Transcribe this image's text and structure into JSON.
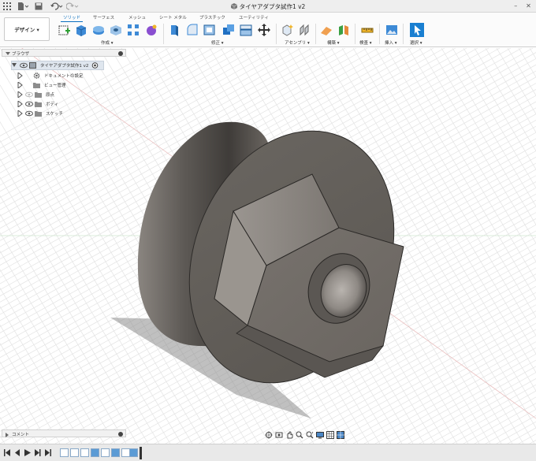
{
  "window": {
    "title": "タイヤアダプタ試作1 v2"
  },
  "ribbon": {
    "workspace_button": "デザイン ▾",
    "tabs": [
      {
        "label": "ソリッド",
        "active": true
      },
      {
        "label": "サーフェス",
        "active": false
      },
      {
        "label": "メッシュ",
        "active": false
      },
      {
        "label": "シート メタル",
        "active": false
      },
      {
        "label": "プラスチック",
        "active": false
      },
      {
        "label": "ユーティリティ",
        "active": false
      }
    ],
    "groups": {
      "create": "作成 ▾",
      "modify": "修正 ▾",
      "assemble": "アセンブリ ▾",
      "construct": "構築 ▾",
      "inspect": "検査 ▾",
      "insert": "挿入 ▾",
      "select": "選択 ▾"
    }
  },
  "browser": {
    "title": "ブラウザ",
    "root": "タイヤアダプタ試作1 v2",
    "items": [
      {
        "label": "ドキュメントの設定",
        "icon": "gear-icon"
      },
      {
        "label": "ビュー管理",
        "icon": "folder-icon"
      },
      {
        "label": "原点",
        "icon": "folder-icon"
      },
      {
        "label": "ボディ",
        "icon": "folder-icon"
      },
      {
        "label": "スケッチ",
        "icon": "folder-icon"
      }
    ]
  },
  "comments": {
    "title": "コメント"
  },
  "colors": {
    "accent": "#0a6fbf",
    "model_body": "#6e6a65",
    "model_face": "#8f8a84",
    "grid": "#e6e6e6"
  }
}
